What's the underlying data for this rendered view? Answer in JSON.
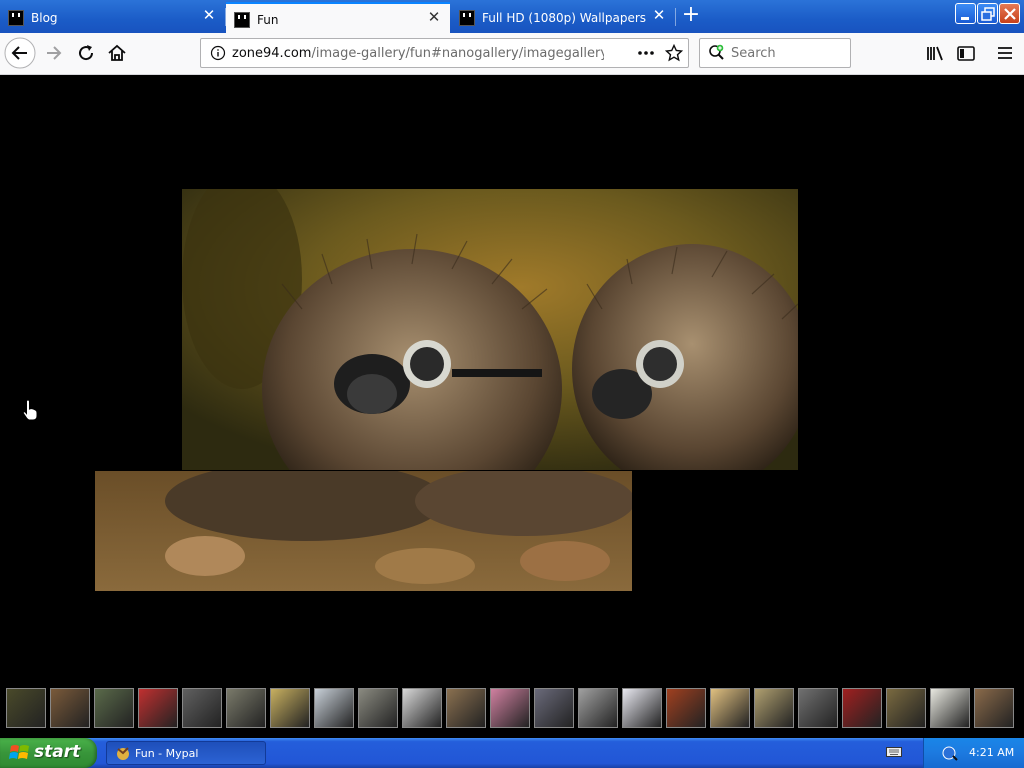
{
  "browser": {
    "tabs": [
      {
        "label": "Blog",
        "active": false
      },
      {
        "label": "Fun",
        "active": true
      },
      {
        "label": "Full HD (1080p) Wallpapers",
        "active": false
      }
    ],
    "url": {
      "host": "zone94.com",
      "path": "/image-gallery/fun#nanogallery/imagegallery-funnyp"
    },
    "search_placeholder": "Search"
  },
  "gallery": {
    "main_image": "hedgehogs-wearing-gas-masks",
    "thumbnail_count": 23
  },
  "taskbar": {
    "start_label": "start",
    "window_label": "Fun - Mypal",
    "clock": "4:21 AM"
  },
  "colors": {
    "titlebar": "#1b5cc7",
    "taskbar": "#245edb",
    "start": "#38953a",
    "tray": "#1c7ae0",
    "accent": "#0a84ff"
  }
}
